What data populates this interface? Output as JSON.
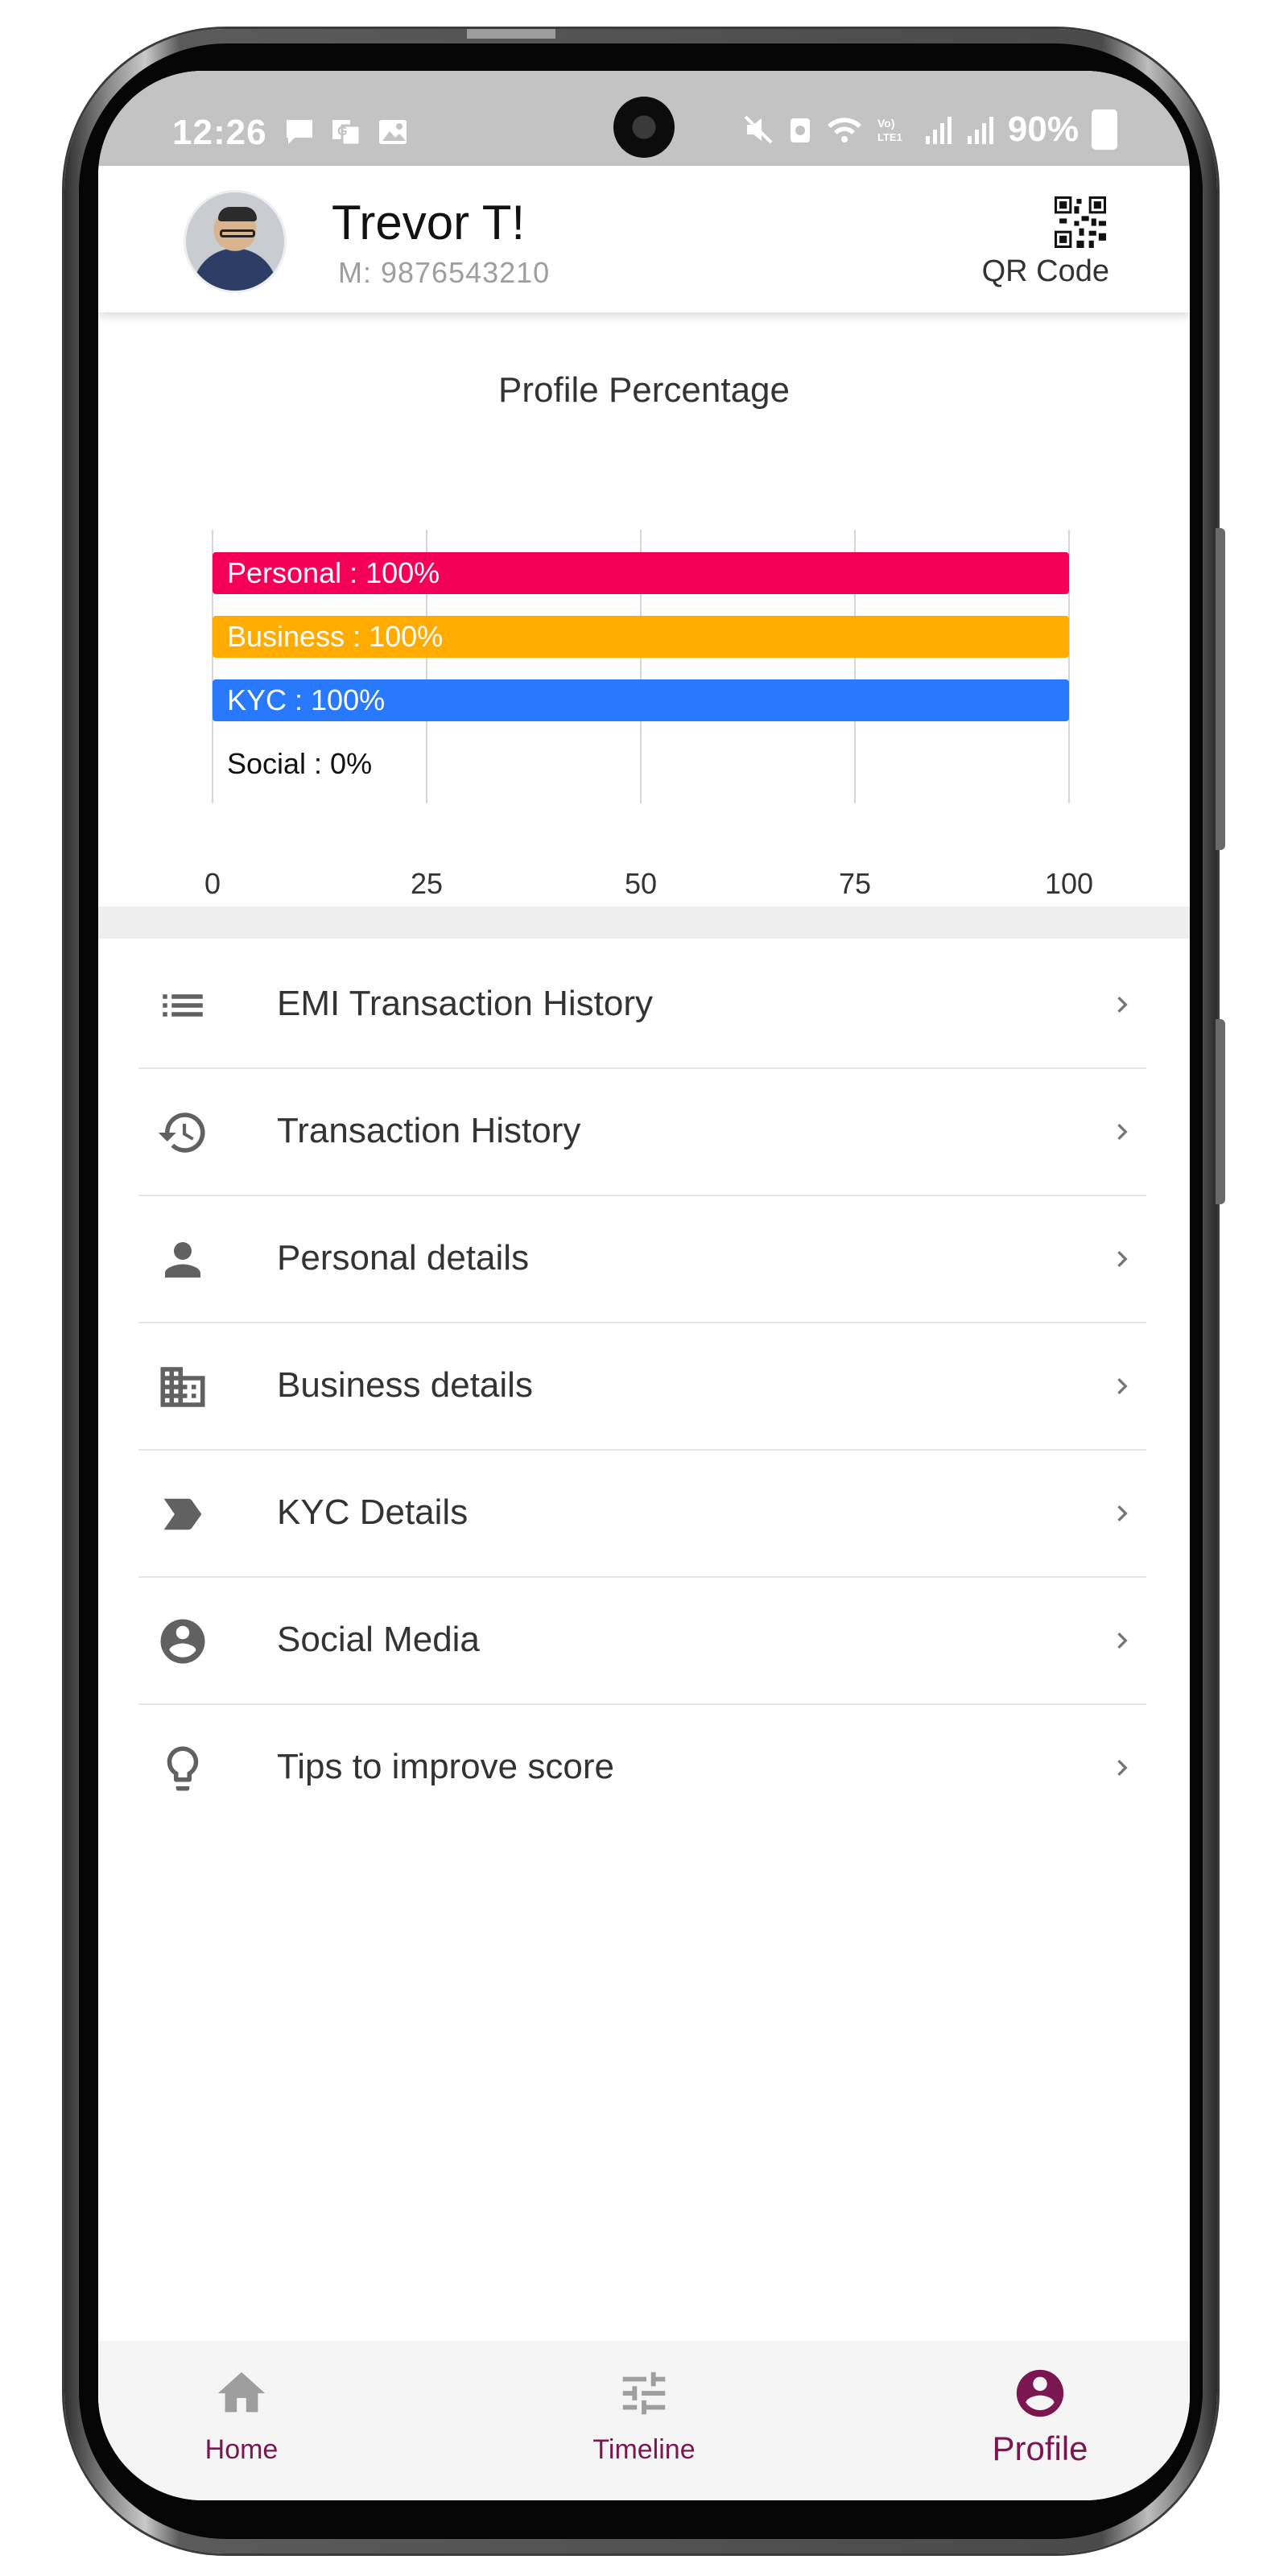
{
  "status_bar": {
    "time": "12:26",
    "battery": "90%"
  },
  "header": {
    "name": "Trevor T!",
    "mobile": "M: 9876543210",
    "qr_label": "QR Code"
  },
  "chart_data": {
    "type": "bar",
    "title": "Profile Percentage",
    "orientation": "horizontal",
    "categories": [
      "Personal",
      "Business",
      "KYC",
      "Social"
    ],
    "values": [
      100,
      100,
      100,
      0
    ],
    "data_labels": [
      "Personal : 100%",
      "Business : 100%",
      "KYC : 100%",
      "Social : 0%"
    ],
    "colors": [
      "#f50057",
      "#ffab00",
      "#2979ff",
      "#9e9e9e"
    ],
    "xlim": [
      0,
      100
    ],
    "xticks": [
      0,
      25,
      50,
      75,
      100
    ],
    "xtick_labels": [
      "0",
      "25",
      "50",
      "75",
      "100"
    ],
    "grid": true
  },
  "menu": {
    "items": [
      {
        "label": "EMI Transaction History",
        "icon": "list-icon"
      },
      {
        "label": "Transaction History",
        "icon": "history-icon"
      },
      {
        "label": "Personal details",
        "icon": "person-icon"
      },
      {
        "label": "Business details",
        "icon": "building-icon"
      },
      {
        "label": "KYC Details",
        "icon": "label-tag-icon"
      },
      {
        "label": "Social Media",
        "icon": "account-circle-icon"
      },
      {
        "label": "Tips to improve score",
        "icon": "lightbulb-icon"
      }
    ]
  },
  "bottom_nav": {
    "items": [
      {
        "label": "Home",
        "icon": "home-icon"
      },
      {
        "label": "Timeline",
        "icon": "tune-icon"
      },
      {
        "label": "Profile",
        "icon": "profile-icon",
        "active": true
      }
    ]
  },
  "colors": {
    "accent": "#7a1650",
    "icon_gray": "#616161"
  }
}
